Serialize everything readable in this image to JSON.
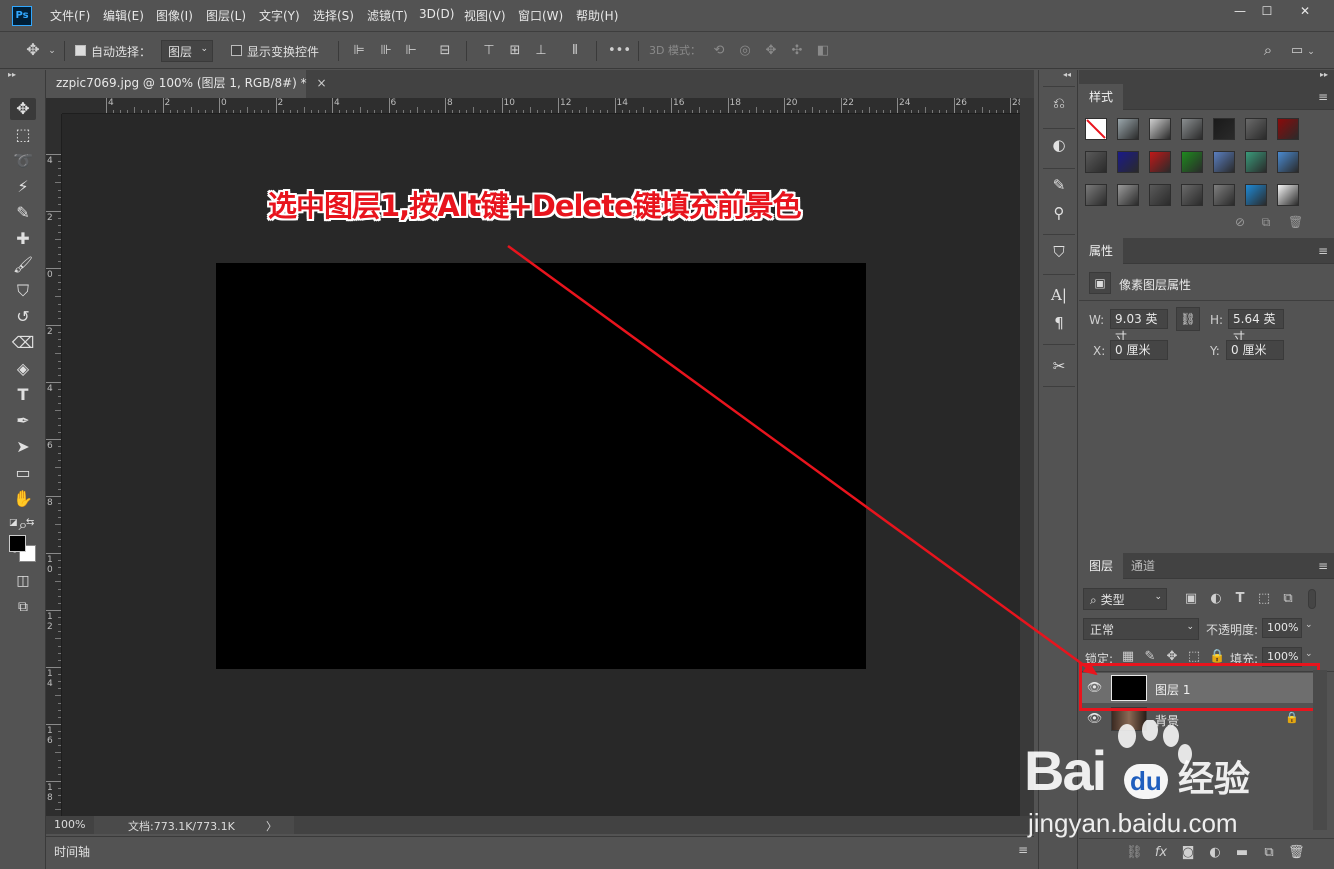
{
  "app": {
    "logo": "Ps"
  },
  "menu": [
    "文件(F)",
    "编辑(E)",
    "图像(I)",
    "图层(L)",
    "文字(Y)",
    "选择(S)",
    "滤镜(T)",
    "3D(D)",
    "视图(V)",
    "窗口(W)",
    "帮助(H)"
  ],
  "window_controls": {
    "minimize": "—",
    "restore": "☐",
    "close": "✕"
  },
  "options_bar": {
    "auto_select_label": "自动选择：",
    "auto_select_checked": true,
    "auto_select_target": "图层",
    "show_transform_label": "显示变换控件",
    "show_transform_checked": false,
    "more": "•••",
    "mode_3d_label": "3D 模式："
  },
  "document": {
    "tab_title": "zzpic7069.jpg @ 100% (图层 1, RGB/8#) *",
    "tab_close": "×",
    "ruler_top_labels": [
      "4",
      "2",
      "0",
      "2",
      "4",
      "6",
      "8",
      "10",
      "12",
      "14",
      "16",
      "18",
      "20",
      "22",
      "24",
      "26",
      "28"
    ],
    "ruler_left_labels": [
      "4",
      "2",
      "0",
      "2",
      "4",
      "6",
      "8",
      "1\n0",
      "1\n2",
      "1\n4",
      "1\n6",
      "1\n8"
    ],
    "canvas_color": "#000000",
    "zoom": "100%",
    "doc_info": "文档:773.1K/773.1K",
    "status_arrow": "〉"
  },
  "annotation": {
    "text": "选中图层1,按Alt键+Delete键填充前景色",
    "color": "#e8141d"
  },
  "timeline": {
    "label": "时间轴"
  },
  "styles_panel": {
    "title": "样式",
    "swatches": [
      "#ffffff",
      "#9aa6ab",
      "#cfcfcf",
      "#8a8e90",
      "#1a1a1a",
      "#6a6a6a",
      "#8b0a0a",
      "#5a5a5a",
      "#1a1a8a",
      "#c01818",
      "#1e8a1e",
      "#5a7fc0",
      "#3a9a7a",
      "#4a8ad0",
      "#7a7a7a",
      "#9a9a9a",
      "#5a5a5a",
      "#6a6a6a",
      "#7e7e7e",
      "#1e8ad6",
      "#f4f4f4"
    ]
  },
  "properties_panel": {
    "title": "属性",
    "subtitle": "像素图层属性",
    "w_label": "W:",
    "w_value": "9.03 英寸",
    "h_label": "H:",
    "h_value": "5.64 英寸",
    "x_label": "X:",
    "x_value": "0 厘米",
    "y_label": "Y:",
    "y_value": "0 厘米"
  },
  "layers_panel": {
    "tabs": [
      "图层",
      "通道"
    ],
    "filter_kind": "类型",
    "blend_mode": "正常",
    "opacity_label": "不透明度:",
    "opacity_value": "100%",
    "lock_label": "锁定:",
    "fill_label": "填充:",
    "fill_value": "100%",
    "layers": [
      {
        "name": "图层 1",
        "selected": true,
        "thumb": "#000000"
      },
      {
        "name": "背景",
        "selected": false,
        "locked": true
      }
    ],
    "highlight_color": "#e8141d"
  },
  "watermark": {
    "brand": "Bai",
    "brand_tail": "经验",
    "paw": "du",
    "url": "jingyan.baidu.com"
  }
}
